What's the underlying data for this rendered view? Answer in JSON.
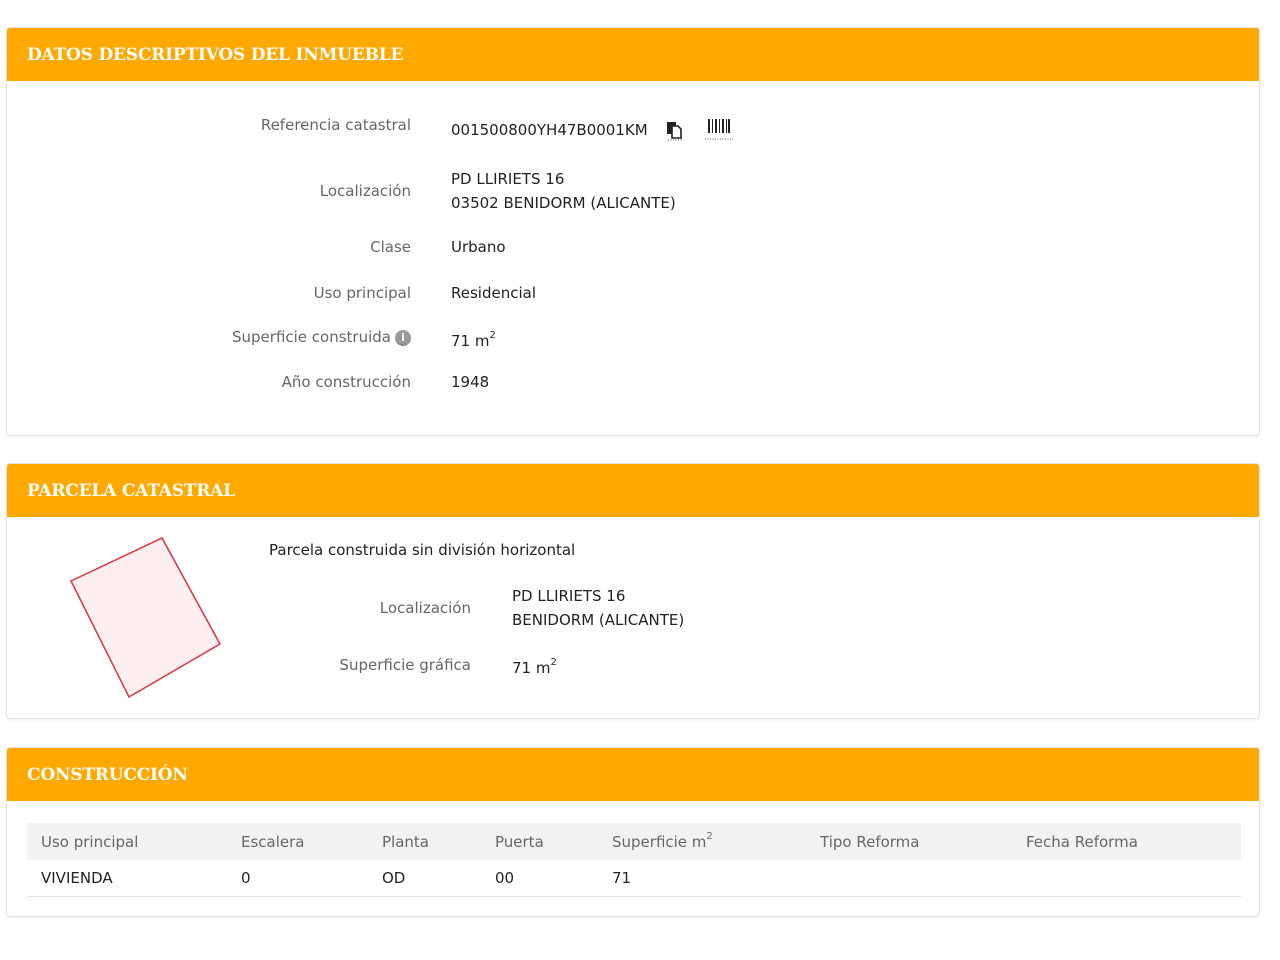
{
  "datos": {
    "header": "DATOS DESCRIPTIVOS DEL INMUEBLE",
    "ref_label": "Referencia catastral",
    "ref_value": "001500800YH47B0001KM",
    "loc_label": "Localización",
    "loc_line1": "PD LLIRIETS 16",
    "loc_line2": "03502 BENIDORM (ALICANTE)",
    "clase_label": "Clase",
    "clase_value": "Urbano",
    "uso_label": "Uso principal",
    "uso_value": "Residencial",
    "sup_label": "Superficie construida",
    "sup_value": "71 m",
    "sup_exp": "2",
    "anio_label": "Año construcción",
    "anio_value": "1948",
    "info_icon": "i"
  },
  "parcela": {
    "header": "PARCELA CATASTRAL",
    "subtitle": "Parcela construida sin división horizontal",
    "loc_label": "Localización",
    "loc_line1": "PD LLIRIETS 16",
    "loc_line2": "BENIDORM (ALICANTE)",
    "sup_label": "Superficie gráfica",
    "sup_value": "71 m",
    "sup_exp": "2",
    "parcel_stroke": "#e0303c",
    "parcel_fill": "#fdeef0"
  },
  "construccion": {
    "header": "CONSTRUCCIÓN",
    "columns": [
      "Uso principal",
      "Escalera",
      "Planta",
      "Puerta",
      "Superficie m",
      "Tipo Reforma",
      "Fecha Reforma"
    ],
    "sup_col_exp": "2",
    "rows": [
      [
        "VIVIENDA",
        "0",
        "OD",
        "00",
        "71",
        "",
        ""
      ]
    ]
  },
  "colors": {
    "header_bg": "#ffa800",
    "header_text": "#ffffff"
  }
}
